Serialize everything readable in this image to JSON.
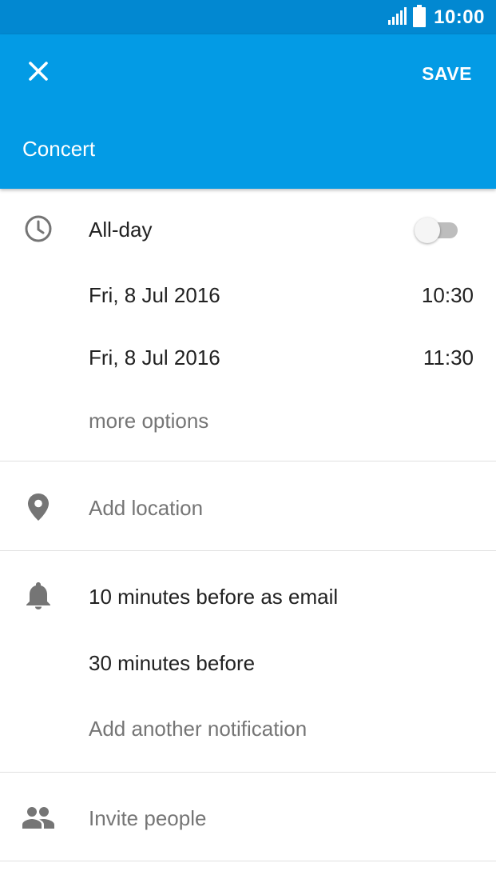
{
  "status_bar": {
    "time": "10:00",
    "icons": [
      "signal-icon",
      "battery-icon"
    ]
  },
  "app_bar": {
    "close_icon": "close-icon",
    "save_label": "SAVE",
    "title_value": "Concert",
    "background_color": "#039be5",
    "status_color": "#0288d1"
  },
  "time_section": {
    "icon": "clock-icon",
    "all_day_label": "All-day",
    "all_day_on": false,
    "start_date": "Fri, 8 Jul 2016",
    "start_time": "10:30",
    "end_date": "Fri, 8 Jul 2016",
    "end_time": "11:30",
    "more_options": "more options"
  },
  "location_section": {
    "icon": "location-pin-icon",
    "placeholder": "Add location"
  },
  "notification_section": {
    "icon": "bell-icon",
    "items": [
      "10 minutes before as email",
      "30 minutes before"
    ],
    "add_label": "Add another notification"
  },
  "people_section": {
    "icon": "people-icon",
    "label": "Invite people"
  }
}
